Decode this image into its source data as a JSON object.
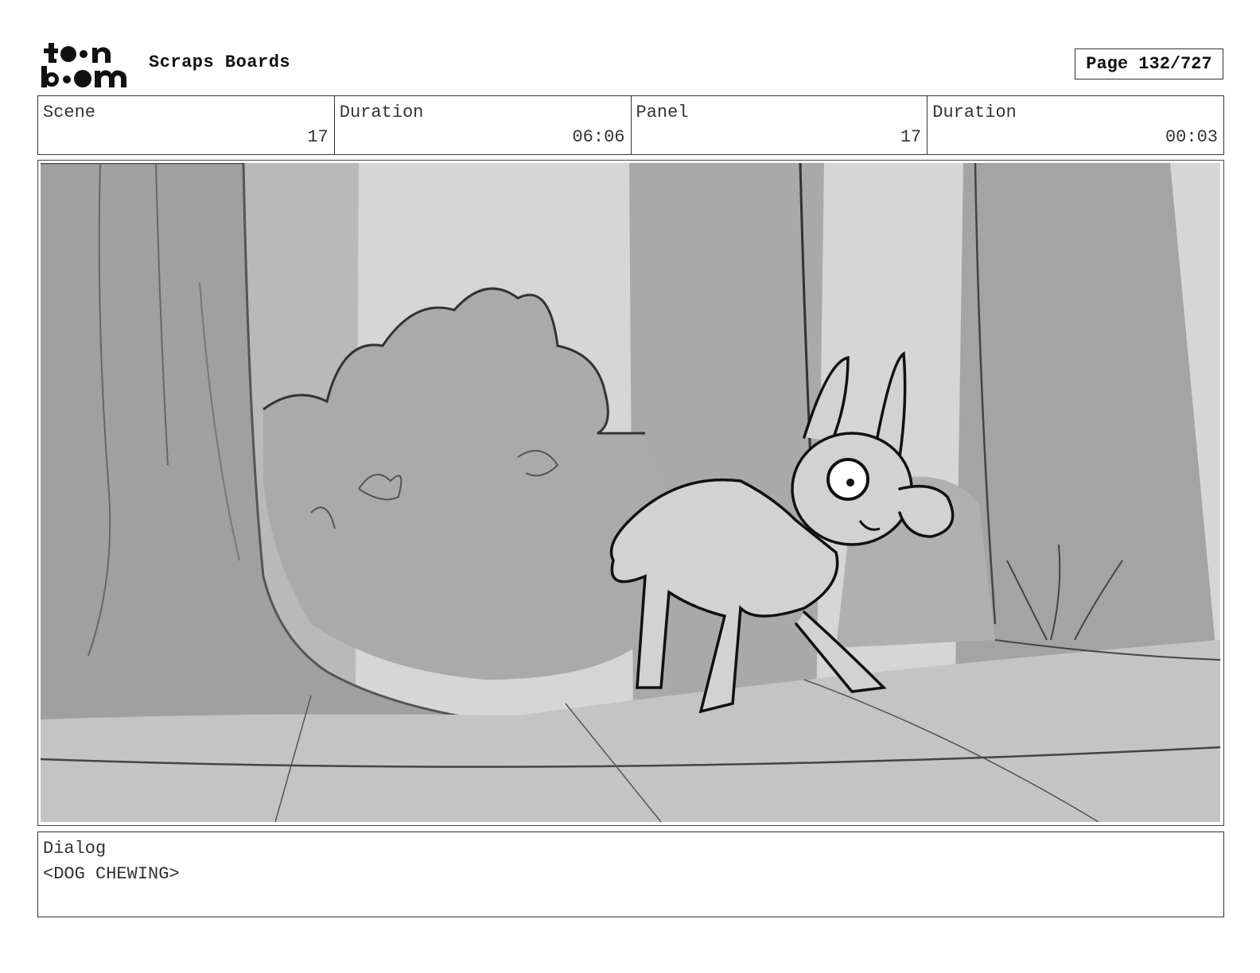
{
  "header": {
    "logo_text": "toon boom",
    "title": "Scraps Boards",
    "page_label": "Page 132/727"
  },
  "info": {
    "scene_label": "Scene",
    "scene_value": "17",
    "scene_duration_label": "Duration",
    "scene_duration_value": "06:06",
    "panel_label": "Panel",
    "panel_value": "17",
    "panel_duration_label": "Duration",
    "panel_duration_value": "00:03"
  },
  "dialog": {
    "label": "Dialog",
    "text": "<DOG CHEWING>"
  }
}
